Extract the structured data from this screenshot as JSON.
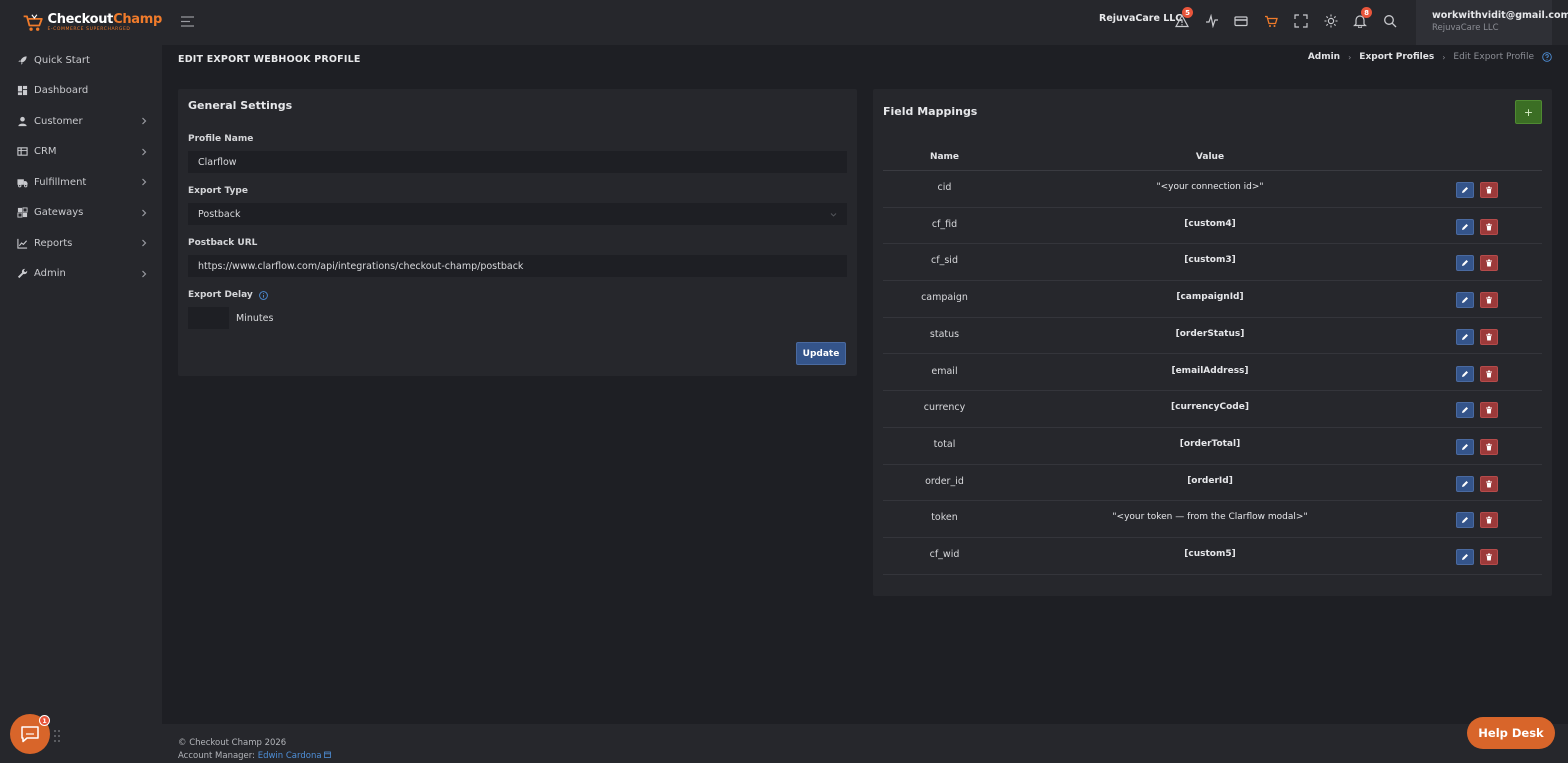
{
  "brand": {
    "name_a": "Checkout",
    "name_b": "Champ",
    "tagline": "E-COMMERCE SUPERCHARGED",
    "accent": "#f07b2b"
  },
  "sidebar": {
    "items": [
      {
        "label": "Quick Start",
        "icon": "rocket-icon"
      },
      {
        "label": "Dashboard",
        "icon": "dashboard-icon"
      },
      {
        "label": "Customer",
        "icon": "user-icon"
      },
      {
        "label": "CRM",
        "icon": "table-icon"
      },
      {
        "label": "Fulfillment",
        "icon": "truck-icon"
      },
      {
        "label": "Gateways",
        "icon": "gateway-icon"
      },
      {
        "label": "Reports",
        "icon": "chart-icon"
      },
      {
        "label": "Admin",
        "icon": "wrench-icon"
      }
    ]
  },
  "topbar": {
    "company": "RejuvaCare LLC",
    "alerts_count": "5",
    "notifications_count": "8",
    "user_email": "workwithvidit@gmail.com",
    "user_company": "RejuvaCare LLC"
  },
  "page": {
    "title": "EDIT EXPORT WEBHOOK PROFILE",
    "breadcrumb": [
      "Admin",
      "Export Profiles",
      "Edit Export Profile"
    ]
  },
  "general": {
    "title": "General Settings",
    "profile_name_label": "Profile Name",
    "profile_name_value": "Clarflow",
    "export_type_label": "Export Type",
    "export_type_value": "Postback",
    "postback_url_label": "Postback URL",
    "postback_url_value": "https://www.clarflow.com/api/integrations/checkout-champ/postback",
    "export_delay_label": "Export Delay",
    "export_delay_unit": "Minutes",
    "update_label": "Update"
  },
  "mappings": {
    "title": "Field Mappings",
    "add_label": "+",
    "col_name": "Name",
    "col_value": "Value",
    "rows": [
      {
        "name": "cid",
        "value": "\"<your connection id>\"",
        "bold": false
      },
      {
        "name": "cf_fid",
        "value": "[custom4]",
        "bold": true
      },
      {
        "name": "cf_sid",
        "value": "[custom3]",
        "bold": true
      },
      {
        "name": "campaign",
        "value": "[campaignId]",
        "bold": true
      },
      {
        "name": "status",
        "value": "[orderStatus]",
        "bold": true
      },
      {
        "name": "email",
        "value": "[emailAddress]",
        "bold": true
      },
      {
        "name": "currency",
        "value": "[currencyCode]",
        "bold": true
      },
      {
        "name": "total",
        "value": "[orderTotal]",
        "bold": true
      },
      {
        "name": "order_id",
        "value": "[orderId]",
        "bold": true
      },
      {
        "name": "token",
        "value": "\"<your token — from the Clarflow modal>\"",
        "bold": false
      },
      {
        "name": "cf_wid",
        "value": "[custom5]",
        "bold": true
      }
    ]
  },
  "footer": {
    "copyright": "© Checkout Champ 2026",
    "account_manager_label": "Account Manager:",
    "account_manager_name": "Edwin Cardona"
  },
  "help": {
    "helpdesk_label": "Help Desk",
    "chat_badge": "1"
  }
}
